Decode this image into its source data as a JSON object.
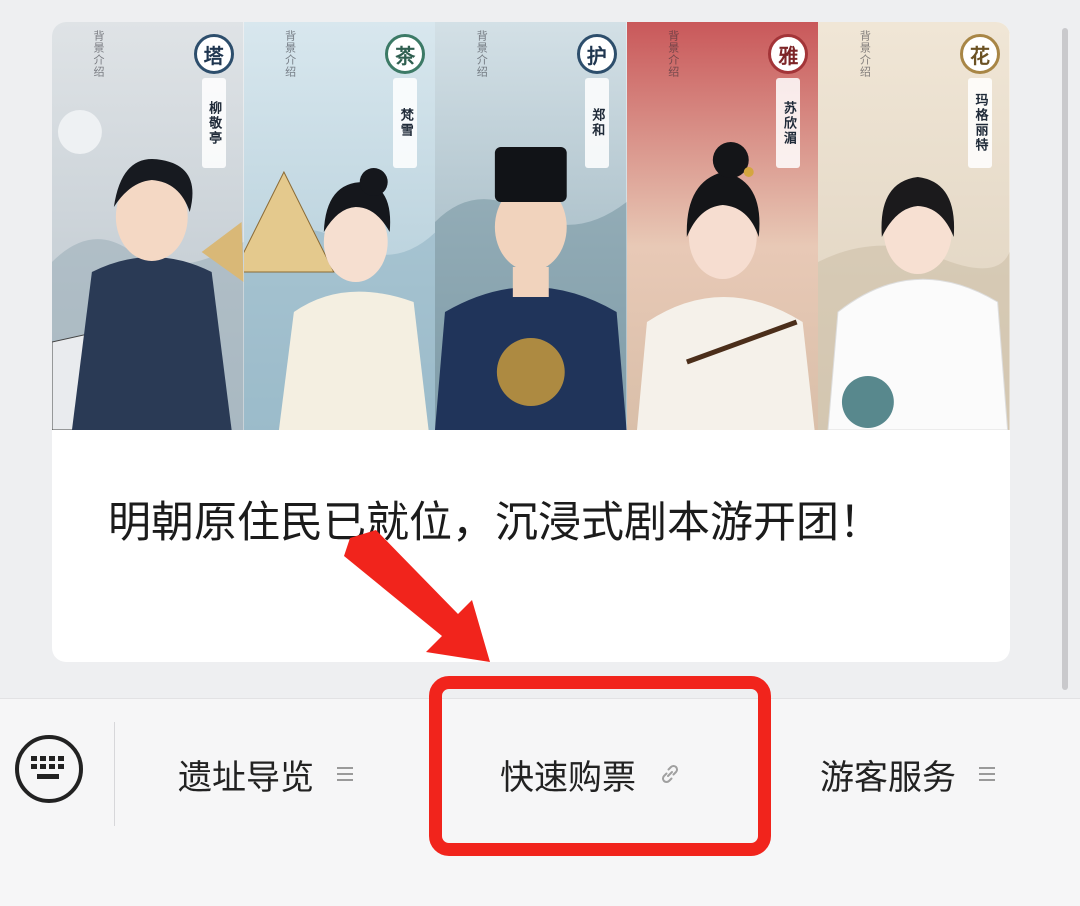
{
  "article": {
    "title": "明朝原住民已就位，沉浸式剧本游开团！",
    "banner": {
      "panels": [
        {
          "badge": "塔",
          "name": "柳敬亭",
          "intro_heading": "背景介绍"
        },
        {
          "badge": "茶",
          "name": "梵雪",
          "intro_heading": "背景介绍"
        },
        {
          "badge": "护",
          "name": "郑和",
          "intro_heading": "背景介绍"
        },
        {
          "badge": "雅",
          "name": "苏欣湄",
          "intro_heading": "背景介绍"
        },
        {
          "badge": "花",
          "name": "玛格丽特",
          "intro_heading": "背景介绍"
        }
      ]
    }
  },
  "menu": {
    "items": [
      {
        "label": "遗址导览",
        "icon": "menu-lines-icon"
      },
      {
        "label": "快速购票",
        "icon": "link-icon"
      },
      {
        "label": "游客服务",
        "icon": "menu-lines-icon"
      }
    ],
    "keyboard_icon": "keyboard-icon"
  },
  "annotation": {
    "color": "#f1241c"
  }
}
